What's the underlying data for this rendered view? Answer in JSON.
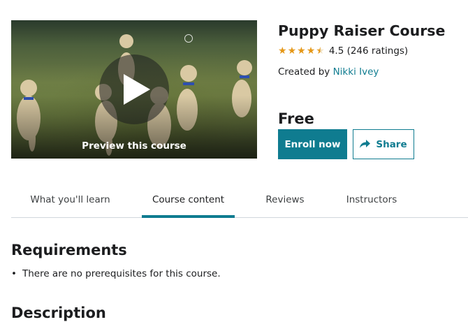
{
  "preview": {
    "label": "Preview this course",
    "icon": "play-icon"
  },
  "course": {
    "title": "Puppy Raiser Course",
    "rating_value": 4.5,
    "rating_text": "4.5 (246 ratings)",
    "created_prefix": "Created by ",
    "instructor": "Nikki Ivey",
    "price": "Free"
  },
  "actions": {
    "enroll_label": "Enroll now",
    "share_label": "Share",
    "share_icon": "share-arrow-icon"
  },
  "tabs": [
    {
      "label": "What you'll learn",
      "active": false
    },
    {
      "label": "Course content",
      "active": true
    },
    {
      "label": "Reviews",
      "active": false
    },
    {
      "label": "Instructors",
      "active": false
    }
  ],
  "requirements": {
    "heading": "Requirements",
    "items": [
      "There are no prerequisites for this course."
    ]
  },
  "description": {
    "heading": "Description"
  },
  "colors": {
    "accent": "#0f7c90",
    "star": "#e59819",
    "text": "#1c1d1f"
  }
}
